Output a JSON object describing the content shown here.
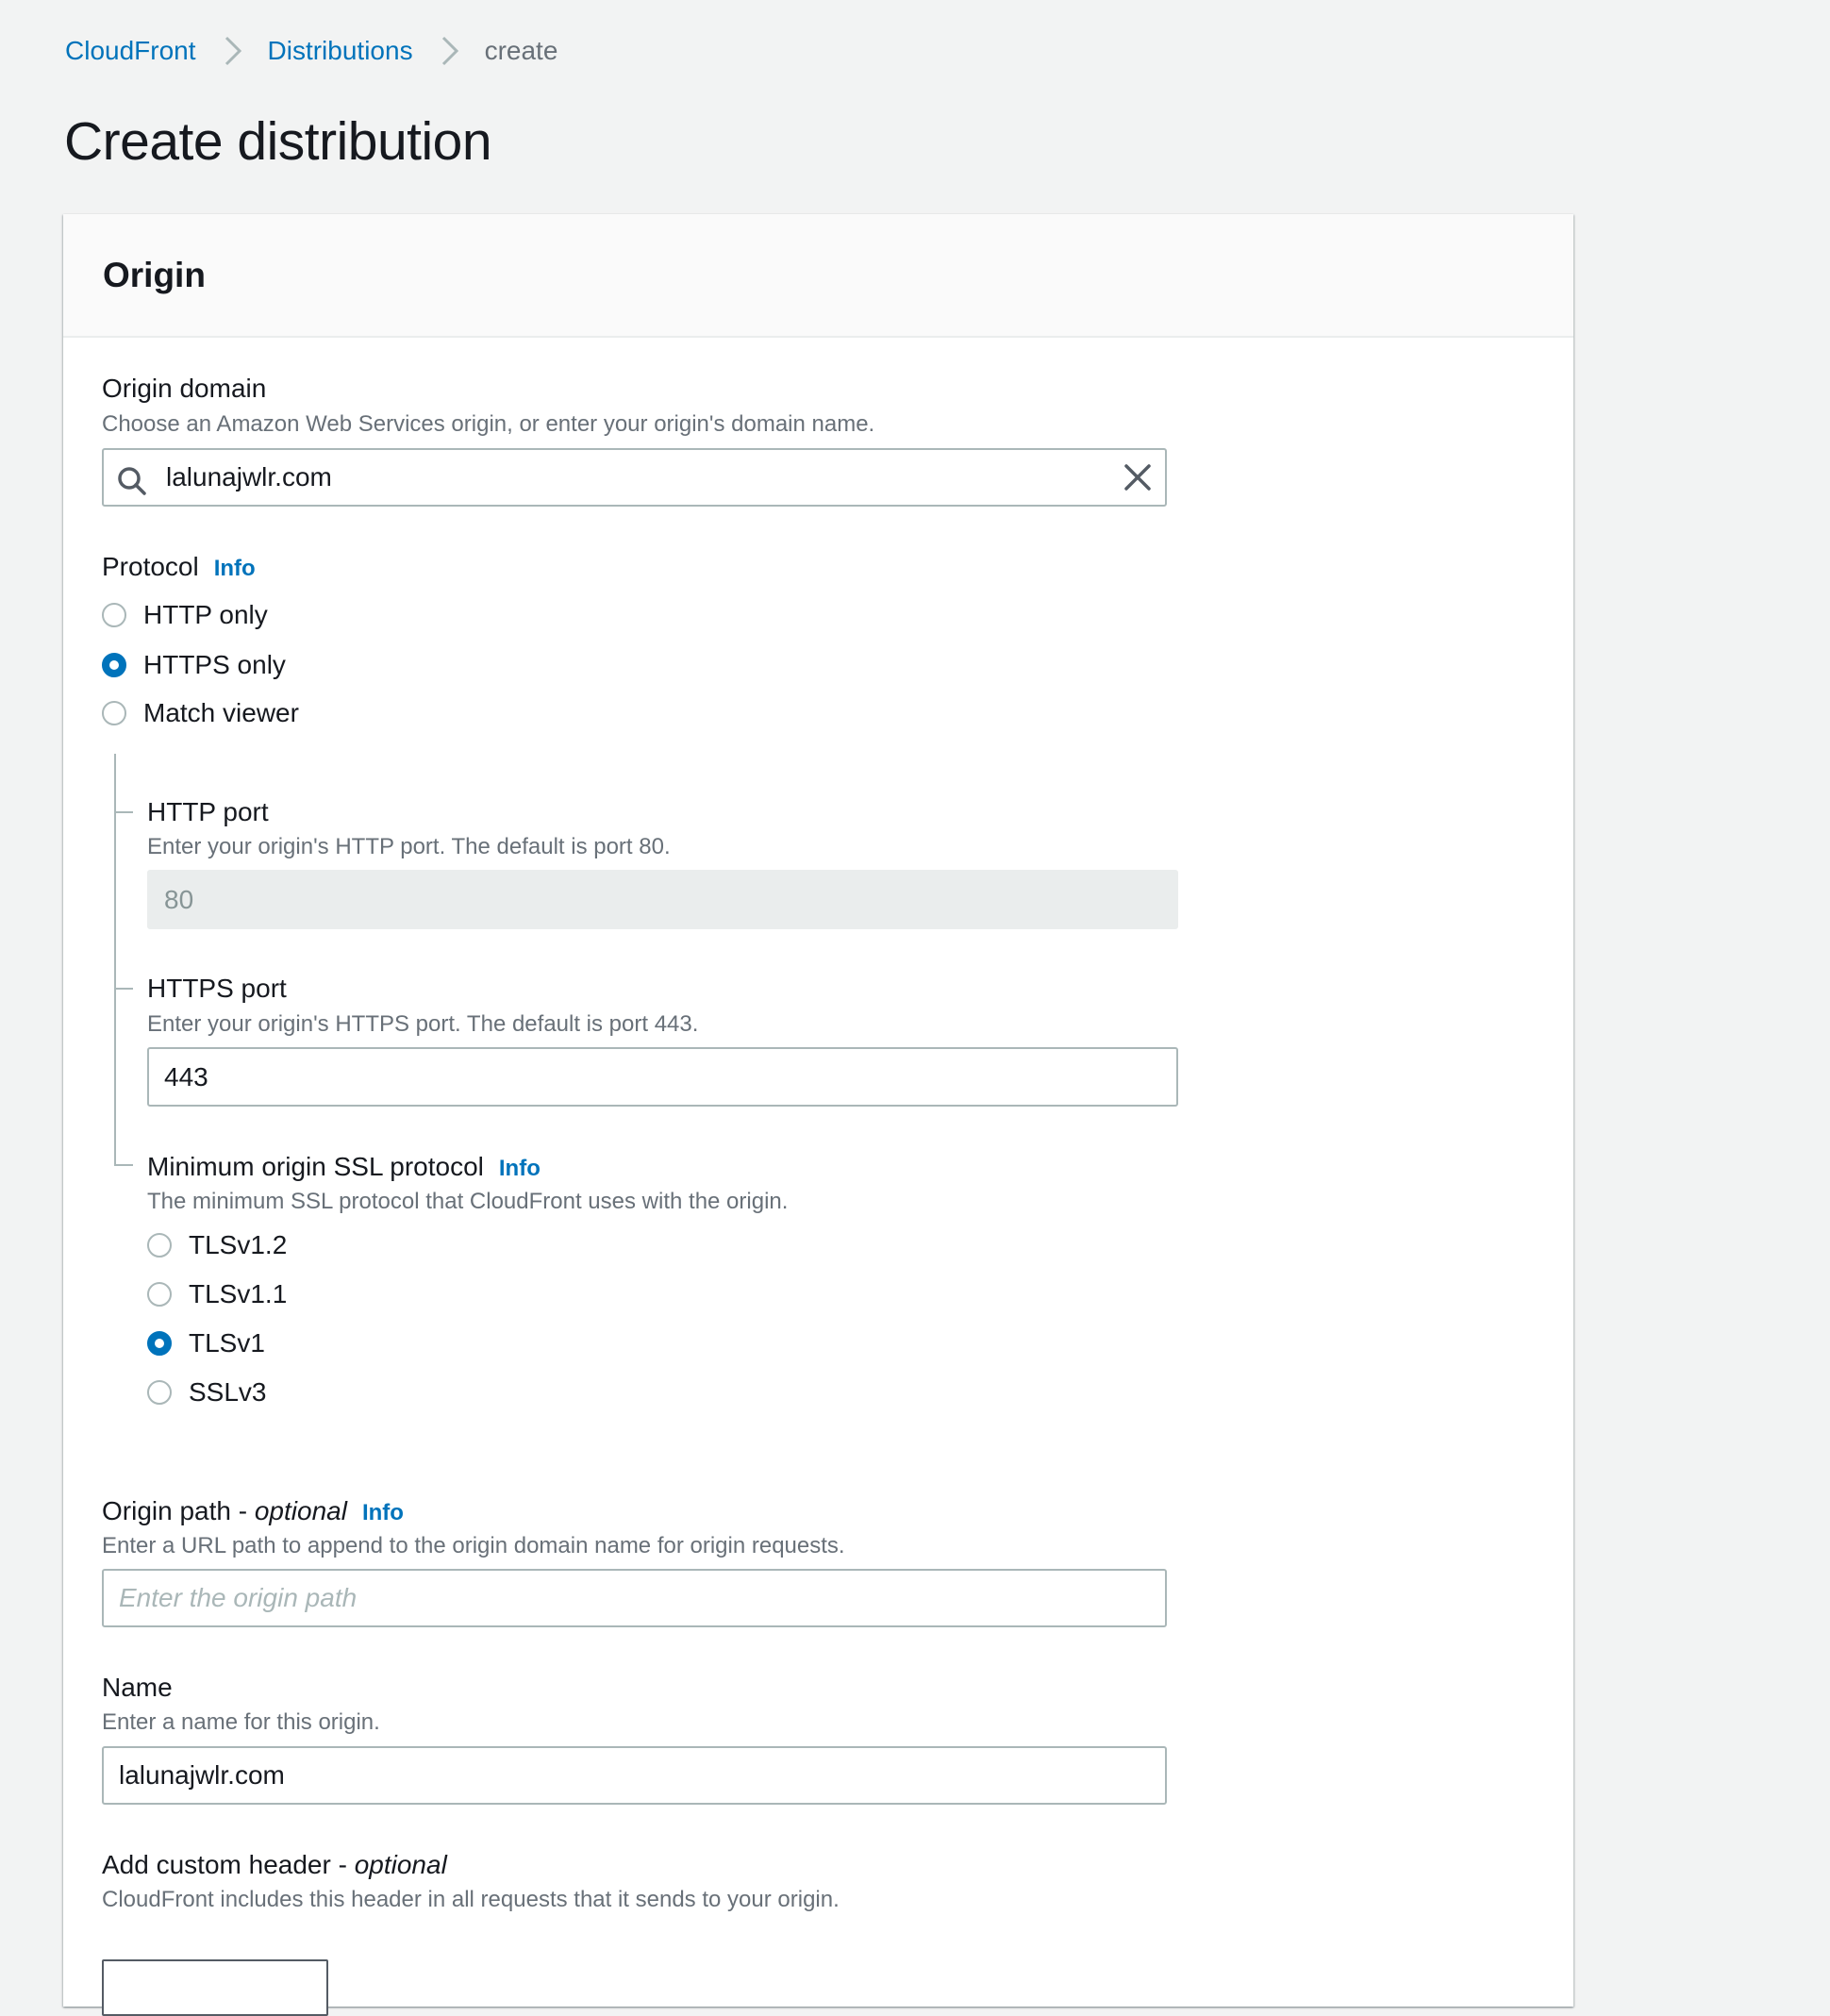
{
  "breadcrumb": {
    "items": [
      {
        "label": "CloudFront",
        "link": true
      },
      {
        "label": "Distributions",
        "link": true
      },
      {
        "label": "create",
        "link": false
      }
    ]
  },
  "page": {
    "title": "Create distribution"
  },
  "origin_panel": {
    "title": "Origin",
    "origin_domain": {
      "label": "Origin domain",
      "hint": "Choose an Amazon Web Services origin, or enter your origin's domain name.",
      "value": "lalunajwlr.com",
      "search_icon": "search-icon",
      "clear_icon": "close-icon"
    },
    "protocol": {
      "label": "Protocol",
      "info": "Info",
      "options": [
        {
          "label": "HTTP only",
          "checked": false
        },
        {
          "label": "HTTPS only",
          "checked": true
        },
        {
          "label": "Match viewer",
          "checked": false
        }
      ],
      "selected": "HTTPS only"
    },
    "http_port": {
      "label": "HTTP port",
      "hint": "Enter your origin's HTTP port. The default is port 80.",
      "value": "80",
      "disabled": true
    },
    "https_port": {
      "label": "HTTPS port",
      "hint": "Enter your origin's HTTPS port. The default is port 443.",
      "value": "443"
    },
    "min_ssl": {
      "label": "Minimum origin SSL protocol",
      "info": "Info",
      "hint": "The minimum SSL protocol that CloudFront uses with the origin.",
      "options": [
        {
          "label": "TLSv1.2",
          "checked": false
        },
        {
          "label": "TLSv1.1",
          "checked": false
        },
        {
          "label": "TLSv1",
          "checked": true
        },
        {
          "label": "SSLv3",
          "checked": false
        }
      ],
      "selected": "TLSv1"
    },
    "origin_path": {
      "label": "Origin path - ",
      "optional": "optional",
      "info": "Info",
      "hint": "Enter a URL path to append to the origin domain name for origin requests.",
      "placeholder": "Enter the origin path",
      "value": ""
    },
    "name": {
      "label": "Name",
      "hint": "Enter a name for this origin.",
      "value": "lalunajwlr.com"
    },
    "custom_header": {
      "label": "Add custom header - ",
      "optional": "optional",
      "hint": "CloudFront includes this header in all requests that it sends to your origin."
    }
  },
  "colors": {
    "accent": "#0073bb",
    "background": "#f2f3f3",
    "text": "#16191f",
    "hint": "#687078",
    "border": "#aab7b8"
  }
}
